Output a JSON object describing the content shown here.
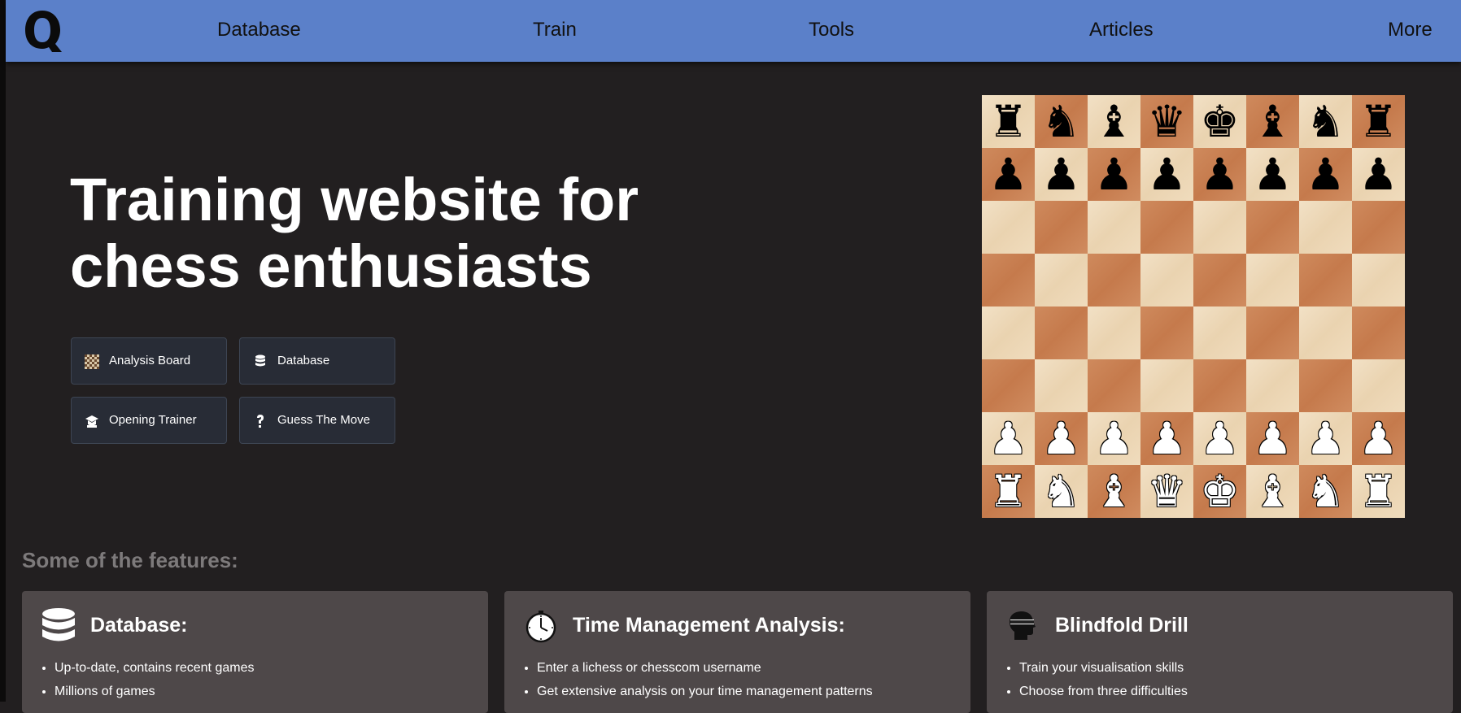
{
  "nav": {
    "items": [
      "Database",
      "Train",
      "Tools",
      "Articles",
      "More"
    ]
  },
  "hero": {
    "title_line1": "Training website for",
    "title_line2": "chess enthusiasts",
    "buttons": [
      {
        "label": "Analysis Board",
        "icon": "checkerboard-icon"
      },
      {
        "label": "Database",
        "icon": "database-icon"
      },
      {
        "label": "Opening Trainer",
        "icon": "graduation-cap-icon"
      },
      {
        "label": "Guess The Move",
        "icon": "question-mark-icon"
      }
    ]
  },
  "board": {
    "ranks": [
      [
        "♜",
        "♞",
        "♝",
        "♛",
        "♚",
        "♝",
        "♞",
        "♜"
      ],
      [
        "♟",
        "♟",
        "♟",
        "♟",
        "♟",
        "♟",
        "♟",
        "♟"
      ],
      [
        "",
        "",
        "",
        "",
        "",
        "",
        "",
        ""
      ],
      [
        "",
        "",
        "",
        "",
        "",
        "",
        "",
        ""
      ],
      [
        "",
        "",
        "",
        "",
        "",
        "",
        "",
        ""
      ],
      [
        "",
        "",
        "",
        "",
        "",
        "",
        "",
        ""
      ],
      [
        "♙",
        "♙",
        "♙",
        "♙",
        "♙",
        "♙",
        "♙",
        "♙"
      ],
      [
        "♖",
        "♘",
        "♗",
        "♕",
        "♔",
        "♗",
        "♘",
        "♖"
      ]
    ],
    "light_color": "#f0dcbd",
    "dark_color": "#cd8558"
  },
  "features": {
    "heading": "Some of the features:",
    "cards": [
      {
        "title": "Database:",
        "icon": "database-icon",
        "bullets": [
          "Up-to-date, contains recent games",
          "Millions of games"
        ]
      },
      {
        "title": "Time Management Analysis:",
        "icon": "clock-icon",
        "bullets": [
          "Enter a lichess or chesscom username",
          "Get extensive analysis on your time management patterns"
        ]
      },
      {
        "title": "Blindfold Drill",
        "icon": "blindfold-head-icon",
        "bullets": [
          "Train your visualisation skills",
          "Choose from three difficulties"
        ]
      }
    ]
  },
  "colors": {
    "nav_bg": "#5b80c9",
    "page_bg": "#221f20",
    "card_bg": "#4e4849",
    "button_bg": "#282c36"
  }
}
